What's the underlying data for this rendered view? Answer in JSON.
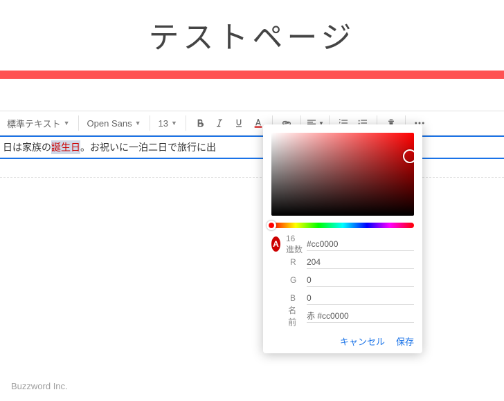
{
  "header": {
    "title": "テストページ"
  },
  "toolbar": {
    "style_dropdown": "標準テキスト",
    "font_dropdown": "Open Sans",
    "font_size": "13"
  },
  "editor": {
    "line1_prefix": "日は家族の",
    "line1_selected": "誕生日",
    "line1_suffix": "。お祝いに一泊二日で旅行に出"
  },
  "colorpicker": {
    "badge_letter": "A",
    "hex_label": "16 進数",
    "hex_value": "#cc0000",
    "r_label": "R",
    "r_value": "204",
    "g_label": "G",
    "g_value": "0",
    "b_label": "B",
    "b_value": "0",
    "name_label": "名前",
    "name_value": "赤 #cc0000",
    "cancel": "キャンセル",
    "save": "保存"
  },
  "footer": {
    "brand": "Buzzword Inc."
  }
}
